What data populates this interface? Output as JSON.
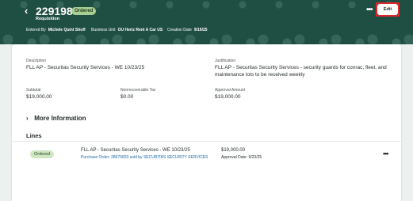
{
  "header": {
    "number": "2291987",
    "status": "Ordered",
    "type": "Requisition",
    "meta": [
      {
        "label": "Entered By",
        "value": "Michele Quint Shuff"
      },
      {
        "label": "Business Unit",
        "value": "OU Hertz Rent A Car US"
      },
      {
        "label": "Creation Date",
        "value": "9/19/25"
      }
    ],
    "edit_label": "Edit",
    "more_icon": "more-horizontal-icon",
    "back_icon": "chevron-left-icon",
    "highlight_color": "#e1262c"
  },
  "details": {
    "description_label": "Description",
    "description": "FLL AP - Securitas Security Services - WE 10/23/25",
    "justification_label": "Justification",
    "justification": "FLL AP - Securitas Security Services - security guards for conrac, fleet, and maintenance lots to be received weekly",
    "subtotal_label": "Subtotal",
    "subtotal": "$19,000.00",
    "tax_label": "Nonrecoverable Tax",
    "tax": "$0.00",
    "approval_label": "Approval Amount",
    "approval": "$19,000.00"
  },
  "more_info": "More Information",
  "lines": {
    "title": "Lines",
    "items": [
      {
        "status": "Ordered",
        "description": "FLL AP - Securitas Security Services - WE 10/23/25",
        "po": "Purchase Order: 28675833 sold by SECURITAS SECURITY SERVICES",
        "amount": "$19,000.00",
        "approval_date": "Approval Date: 9/23/25"
      }
    ]
  }
}
